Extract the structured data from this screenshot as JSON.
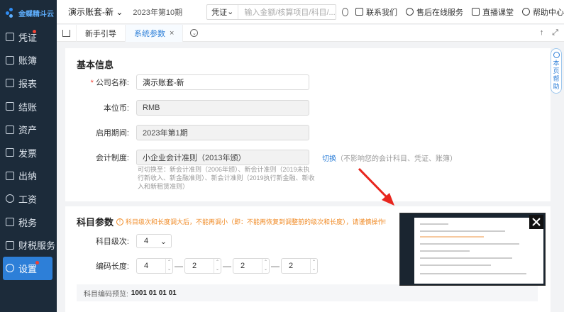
{
  "sidebar": {
    "logo_text": "金蝶精斗云",
    "items": [
      {
        "label": "凭证",
        "badge": true
      },
      {
        "label": "账簿",
        "badge": false
      },
      {
        "label": "报表",
        "badge": false
      },
      {
        "label": "结账",
        "badge": false
      },
      {
        "label": "资产",
        "badge": false
      },
      {
        "label": "发票",
        "badge": false
      },
      {
        "label": "出纳",
        "badge": false
      },
      {
        "label": "工资",
        "badge": false
      },
      {
        "label": "税务",
        "badge": false
      },
      {
        "label": "财税服务",
        "badge": false
      },
      {
        "label": "设置",
        "badge": true,
        "active": true
      }
    ]
  },
  "topbar": {
    "account": "演示账套-新",
    "period": "2023年第10期",
    "search_type": "凭证",
    "search_placeholder": "输入金额/核算项目/科目/...",
    "links": [
      "联系我们",
      "售后在线服务",
      "直播课堂",
      "帮助中心"
    ]
  },
  "tabs": {
    "items": [
      "新手引导",
      "系统参数"
    ],
    "active": "系统参数",
    "close_glyph": "×"
  },
  "help_side": {
    "label_1": "本",
    "label_2": "页",
    "label_3": "帮",
    "label_4": "助"
  },
  "basic": {
    "title": "基本信息",
    "company_label": "公司名称:",
    "company_value": "演示账套-新",
    "currency_label": "本位币:",
    "currency_value": "RMB",
    "start_label": "启用期间:",
    "start_value": "2023年第1期",
    "system_label": "会计制度:",
    "system_value": "小企业会计准则（2013年颁）",
    "switch_link": "切换",
    "switch_note": "（不影响您的会计科目、凭证、账簿）",
    "hint": "可切换至：新会计准则（2006年颁）、新会计准则（2019未执行新收入、新金融准则）、新会计准则（2019执行新金融、新收入和新租赁准则）"
  },
  "subject": {
    "title": "科目参数",
    "warning": "科目级次和长度调大后，不能再调小（即：不能再恢复到调整前的级次和长度），请谨慎操作!",
    "level_label": "科目级次:",
    "level_value": "4",
    "length_label": "编码长度:",
    "lengths": [
      "4",
      "2",
      "2",
      "2"
    ],
    "preview_label": "科目编码预览:",
    "preview_value": "1001 01 01 01"
  },
  "colors": {
    "sidebar": "#1c2b3a",
    "accent": "#2d7fd8",
    "warning": "#f08a24",
    "annotation_arrow": "#e8261e"
  }
}
